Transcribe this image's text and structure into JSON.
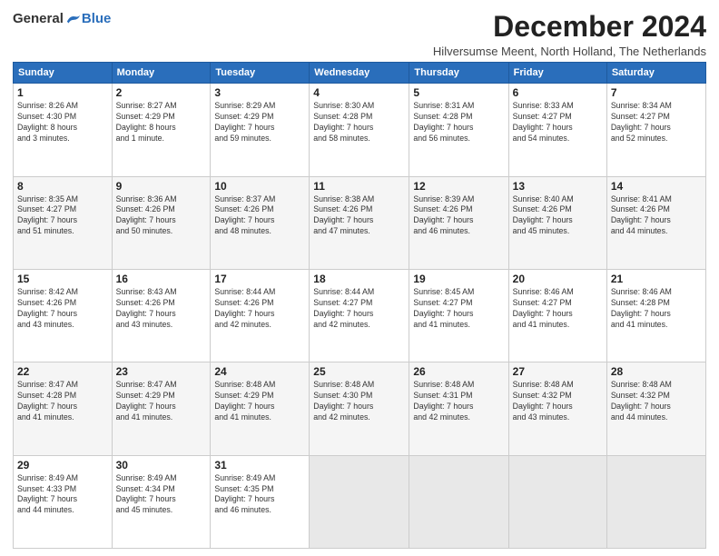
{
  "logo": {
    "general": "General",
    "blue": "Blue"
  },
  "title": "December 2024",
  "location": "Hilversumse Meent, North Holland, The Netherlands",
  "days_of_week": [
    "Sunday",
    "Monday",
    "Tuesday",
    "Wednesday",
    "Thursday",
    "Friday",
    "Saturday"
  ],
  "weeks": [
    [
      {
        "day": "1",
        "info": "Sunrise: 8:26 AM\nSunset: 4:30 PM\nDaylight: 8 hours\nand 3 minutes."
      },
      {
        "day": "2",
        "info": "Sunrise: 8:27 AM\nSunset: 4:29 PM\nDaylight: 8 hours\nand 1 minute."
      },
      {
        "day": "3",
        "info": "Sunrise: 8:29 AM\nSunset: 4:29 PM\nDaylight: 7 hours\nand 59 minutes."
      },
      {
        "day": "4",
        "info": "Sunrise: 8:30 AM\nSunset: 4:28 PM\nDaylight: 7 hours\nand 58 minutes."
      },
      {
        "day": "5",
        "info": "Sunrise: 8:31 AM\nSunset: 4:28 PM\nDaylight: 7 hours\nand 56 minutes."
      },
      {
        "day": "6",
        "info": "Sunrise: 8:33 AM\nSunset: 4:27 PM\nDaylight: 7 hours\nand 54 minutes."
      },
      {
        "day": "7",
        "info": "Sunrise: 8:34 AM\nSunset: 4:27 PM\nDaylight: 7 hours\nand 52 minutes."
      }
    ],
    [
      {
        "day": "8",
        "info": "Sunrise: 8:35 AM\nSunset: 4:27 PM\nDaylight: 7 hours\nand 51 minutes."
      },
      {
        "day": "9",
        "info": "Sunrise: 8:36 AM\nSunset: 4:26 PM\nDaylight: 7 hours\nand 50 minutes."
      },
      {
        "day": "10",
        "info": "Sunrise: 8:37 AM\nSunset: 4:26 PM\nDaylight: 7 hours\nand 48 minutes."
      },
      {
        "day": "11",
        "info": "Sunrise: 8:38 AM\nSunset: 4:26 PM\nDaylight: 7 hours\nand 47 minutes."
      },
      {
        "day": "12",
        "info": "Sunrise: 8:39 AM\nSunset: 4:26 PM\nDaylight: 7 hours\nand 46 minutes."
      },
      {
        "day": "13",
        "info": "Sunrise: 8:40 AM\nSunset: 4:26 PM\nDaylight: 7 hours\nand 45 minutes."
      },
      {
        "day": "14",
        "info": "Sunrise: 8:41 AM\nSunset: 4:26 PM\nDaylight: 7 hours\nand 44 minutes."
      }
    ],
    [
      {
        "day": "15",
        "info": "Sunrise: 8:42 AM\nSunset: 4:26 PM\nDaylight: 7 hours\nand 43 minutes."
      },
      {
        "day": "16",
        "info": "Sunrise: 8:43 AM\nSunset: 4:26 PM\nDaylight: 7 hours\nand 43 minutes."
      },
      {
        "day": "17",
        "info": "Sunrise: 8:44 AM\nSunset: 4:26 PM\nDaylight: 7 hours\nand 42 minutes."
      },
      {
        "day": "18",
        "info": "Sunrise: 8:44 AM\nSunset: 4:27 PM\nDaylight: 7 hours\nand 42 minutes."
      },
      {
        "day": "19",
        "info": "Sunrise: 8:45 AM\nSunset: 4:27 PM\nDaylight: 7 hours\nand 41 minutes."
      },
      {
        "day": "20",
        "info": "Sunrise: 8:46 AM\nSunset: 4:27 PM\nDaylight: 7 hours\nand 41 minutes."
      },
      {
        "day": "21",
        "info": "Sunrise: 8:46 AM\nSunset: 4:28 PM\nDaylight: 7 hours\nand 41 minutes."
      }
    ],
    [
      {
        "day": "22",
        "info": "Sunrise: 8:47 AM\nSunset: 4:28 PM\nDaylight: 7 hours\nand 41 minutes."
      },
      {
        "day": "23",
        "info": "Sunrise: 8:47 AM\nSunset: 4:29 PM\nDaylight: 7 hours\nand 41 minutes."
      },
      {
        "day": "24",
        "info": "Sunrise: 8:48 AM\nSunset: 4:29 PM\nDaylight: 7 hours\nand 41 minutes."
      },
      {
        "day": "25",
        "info": "Sunrise: 8:48 AM\nSunset: 4:30 PM\nDaylight: 7 hours\nand 42 minutes."
      },
      {
        "day": "26",
        "info": "Sunrise: 8:48 AM\nSunset: 4:31 PM\nDaylight: 7 hours\nand 42 minutes."
      },
      {
        "day": "27",
        "info": "Sunrise: 8:48 AM\nSunset: 4:32 PM\nDaylight: 7 hours\nand 43 minutes."
      },
      {
        "day": "28",
        "info": "Sunrise: 8:48 AM\nSunset: 4:32 PM\nDaylight: 7 hours\nand 44 minutes."
      }
    ],
    [
      {
        "day": "29",
        "info": "Sunrise: 8:49 AM\nSunset: 4:33 PM\nDaylight: 7 hours\nand 44 minutes."
      },
      {
        "day": "30",
        "info": "Sunrise: 8:49 AM\nSunset: 4:34 PM\nDaylight: 7 hours\nand 45 minutes."
      },
      {
        "day": "31",
        "info": "Sunrise: 8:49 AM\nSunset: 4:35 PM\nDaylight: 7 hours\nand 46 minutes."
      },
      {
        "day": "",
        "info": ""
      },
      {
        "day": "",
        "info": ""
      },
      {
        "day": "",
        "info": ""
      },
      {
        "day": "",
        "info": ""
      }
    ]
  ]
}
